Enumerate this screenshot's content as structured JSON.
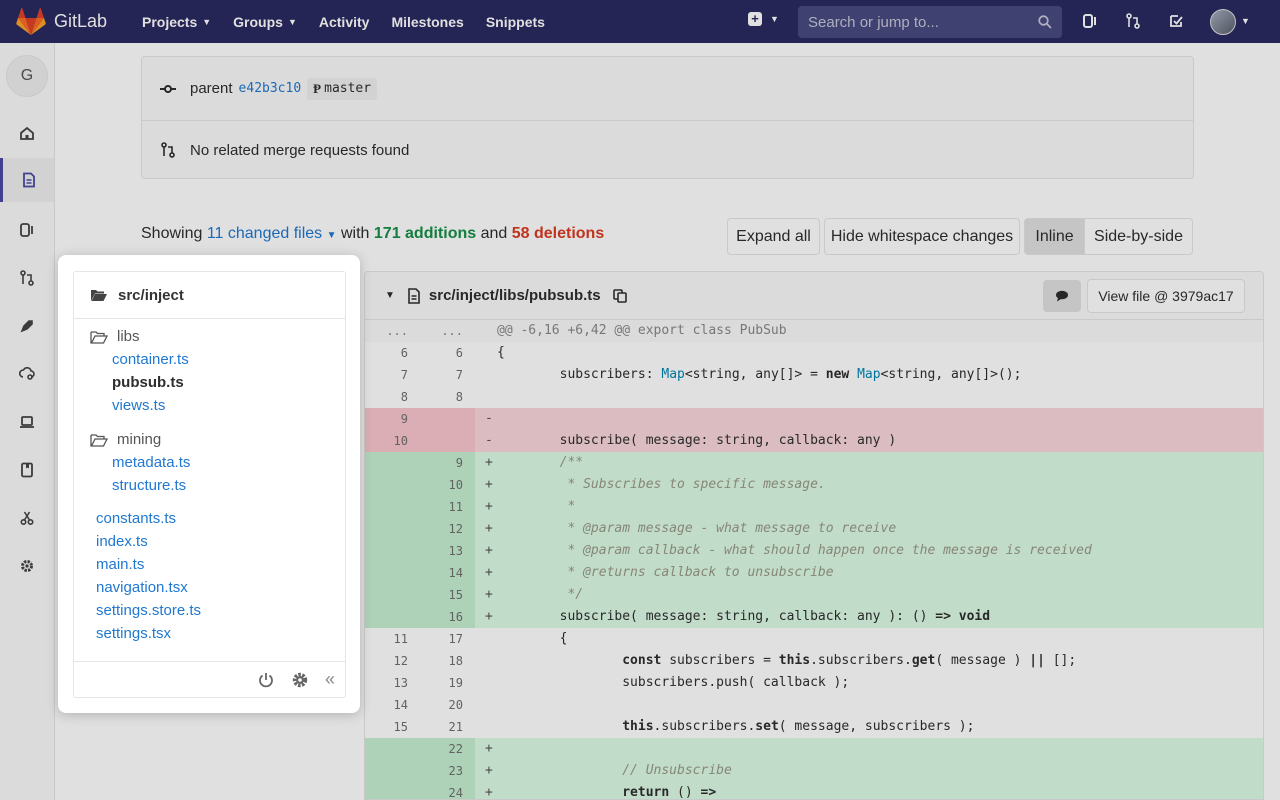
{
  "navbar": {
    "brand": "GitLab",
    "links": [
      "Projects",
      "Groups",
      "Activity",
      "Milestones",
      "Snippets"
    ],
    "search_placeholder": "Search or jump to...",
    "icons": [
      "new-icon",
      "search-icon",
      "issues-icon",
      "merge-requests-icon",
      "todos-icon"
    ]
  },
  "sidebar": {
    "project_letter": "G",
    "icons": [
      "home-icon",
      "repository-icon",
      "issues-icon",
      "merge-requests-icon",
      "ci-cd-icon",
      "operations-icon",
      "environments-icon",
      "wiki-icon",
      "snippets-icon",
      "settings-icon"
    ]
  },
  "commit_info": {
    "parent_label": "parent",
    "parent_sha": "e42b3c10",
    "branch": "master",
    "merge_requests_text": "No related merge requests found"
  },
  "summary": {
    "showing": "Showing",
    "changed_files": "11 changed files",
    "with": "with",
    "additions": "171 additions",
    "and": "and",
    "deletions": "58 deletions"
  },
  "buttons": {
    "expand_all": "Expand all",
    "hide_whitespace": "Hide whitespace changes",
    "inline": "Inline",
    "side_by_side": "Side-by-side"
  },
  "diff": {
    "file_path": "src/inject/libs/pubsub.ts",
    "view_file": "View file @ 3979ac17",
    "lines": [
      {
        "type": "match",
        "old": "...",
        "new": "...",
        "sign": "",
        "code": "@@ -6,16 +6,42 @@ export class PubSub"
      },
      {
        "type": "normal",
        "old": "6",
        "new": "6",
        "sign": "",
        "code": "{"
      },
      {
        "type": "normal",
        "old": "7",
        "new": "7",
        "sign": "",
        "code": "        subscribers: Map<string, any[]> = new Map<string, any[]>();"
      },
      {
        "type": "normal",
        "old": "8",
        "new": "8",
        "sign": "",
        "code": ""
      },
      {
        "type": "del",
        "old": "9",
        "new": "",
        "sign": "-",
        "code": ""
      },
      {
        "type": "del",
        "old": "10",
        "new": "",
        "sign": "-",
        "code": "        subscribe( message: string, callback: any )"
      },
      {
        "type": "add",
        "old": "",
        "new": "9",
        "sign": "+",
        "code": "        /**"
      },
      {
        "type": "add",
        "old": "",
        "new": "10",
        "sign": "+",
        "code": "         * Subscribes to specific message."
      },
      {
        "type": "add",
        "old": "",
        "new": "11",
        "sign": "+",
        "code": "         *"
      },
      {
        "type": "add",
        "old": "",
        "new": "12",
        "sign": "+",
        "code": "         * @param message - what message to receive"
      },
      {
        "type": "add",
        "old": "",
        "new": "13",
        "sign": "+",
        "code": "         * @param callback - what should happen once the message is received"
      },
      {
        "type": "add",
        "old": "",
        "new": "14",
        "sign": "+",
        "code": "         * @returns callback to unsubscribe"
      },
      {
        "type": "add",
        "old": "",
        "new": "15",
        "sign": "+",
        "code": "         */"
      },
      {
        "type": "add",
        "old": "",
        "new": "16",
        "sign": "+",
        "code": "        subscribe( message: string, callback: any ): () => void"
      },
      {
        "type": "normal",
        "old": "11",
        "new": "17",
        "sign": "",
        "code": "        {"
      },
      {
        "type": "normal",
        "old": "12",
        "new": "18",
        "sign": "",
        "code": "                const subscribers = this.subscribers.get( message ) || [];"
      },
      {
        "type": "normal",
        "old": "13",
        "new": "19",
        "sign": "",
        "code": "                subscribers.push( callback );"
      },
      {
        "type": "normal",
        "old": "14",
        "new": "20",
        "sign": "",
        "code": ""
      },
      {
        "type": "normal",
        "old": "15",
        "new": "21",
        "sign": "",
        "code": "                this.subscribers.set( message, subscribers );"
      },
      {
        "type": "add",
        "old": "",
        "new": "22",
        "sign": "+",
        "code": ""
      },
      {
        "type": "add",
        "old": "",
        "new": "23",
        "sign": "+",
        "code": "                // Unsubscribe"
      },
      {
        "type": "add",
        "old": "",
        "new": "24",
        "sign": "+",
        "code": "                return () =>"
      }
    ]
  },
  "tree": {
    "root": "src/inject",
    "folders": [
      {
        "name": "libs",
        "files": [
          "container.ts",
          "pubsub.ts",
          "views.ts"
        ]
      },
      {
        "name": "mining",
        "files": [
          "metadata.ts",
          "structure.ts"
        ]
      }
    ],
    "root_files": [
      "constants.ts",
      "index.ts",
      "main.ts",
      "navigation.tsx",
      "settings.store.ts",
      "settings.tsx"
    ],
    "current_file": "pubsub.ts"
  },
  "colors": {
    "navbar": "#292961",
    "link": "#1f78d1",
    "additions": "#168f48",
    "deletions": "#db3b21"
  }
}
